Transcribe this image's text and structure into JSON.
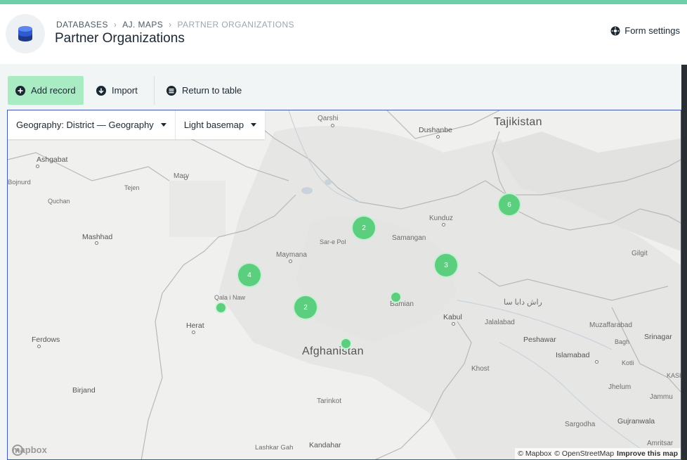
{
  "breadcrumb": {
    "items": [
      "DATABASES",
      "AJ. MAPS",
      "PARTNER ORGANIZATIONS"
    ]
  },
  "page_title": "Partner Organizations",
  "header": {
    "form_settings_label": "Form settings"
  },
  "toolbar": {
    "add_record_label": "Add record",
    "import_label": "Import",
    "return_label": "Return to table"
  },
  "map_controls": {
    "geography_select": "Geography: District — Geography",
    "basemap_select": "Light basemap"
  },
  "map": {
    "country_labels": [
      "Tajikistan",
      "Afghanistan"
    ],
    "city_labels": [
      "Qarshi",
      "Dushanbe",
      "Ashgabat",
      "Mary",
      "Tejen",
      "Quchan",
      "Mashhad",
      "Kunduz",
      "Samangan",
      "Sar-e Pol",
      "Maymana",
      "Qala i Naw",
      "Herat",
      "Bamian",
      "Kabul",
      "Jalalabad",
      "Peshawar",
      "Gilgit",
      "Muzaffarabad",
      "Srinagar",
      "Islamabad",
      "Bagh",
      "Kotli",
      "Jhelum",
      "Jammu",
      "Sargodha",
      "Gujranwala",
      "Amritsar",
      "Khost",
      "Ferdows",
      "Birjand",
      "Tarinkot",
      "Kandahar",
      "Lashkar Gah",
      "Bojnurd",
      "KASH",
      "راش دابا سا"
    ],
    "clusters": [
      {
        "count": "6"
      },
      {
        "count": "2"
      },
      {
        "count": "3"
      },
      {
        "count": "4"
      },
      {
        "count": "2"
      }
    ],
    "markers_count": 3,
    "marker_color": "#5ccf7e",
    "logo_text": "mapbox",
    "attribution": {
      "mapbox": "© Mapbox",
      "osm": "© OpenStreetMap",
      "improve": "Improve this map"
    }
  },
  "colors": {
    "accent_stripe": "#6ccfa8",
    "add_button_bg": "#a9ecc4",
    "map_border": "#4157b8"
  }
}
